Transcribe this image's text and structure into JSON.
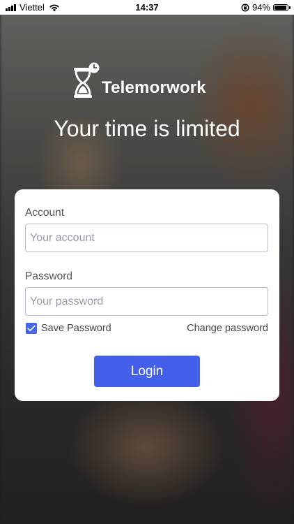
{
  "status_bar": {
    "carrier": "Viettel",
    "time": "14:37",
    "battery_percent": "94%",
    "battery_level": 0.94,
    "icons": [
      "signal-bars-icon",
      "wifi-icon",
      "rotation-lock-icon",
      "battery-icon"
    ]
  },
  "brand": {
    "app_name": "Telemorwork",
    "logo_icon": "hourglass-clock-icon"
  },
  "tagline": "Your time is limited",
  "login_form": {
    "account": {
      "label": "Account",
      "placeholder": "Your account",
      "value": ""
    },
    "password": {
      "label": "Password",
      "placeholder": "Your password",
      "value": ""
    },
    "save_password": {
      "label": "Save Password",
      "checked": true
    },
    "change_password_link": "Change password",
    "login_button": "Login"
  },
  "colors": {
    "accent": "#4460EA",
    "card_background": "#FFFFFF",
    "field_border": "#B9B7E0"
  }
}
